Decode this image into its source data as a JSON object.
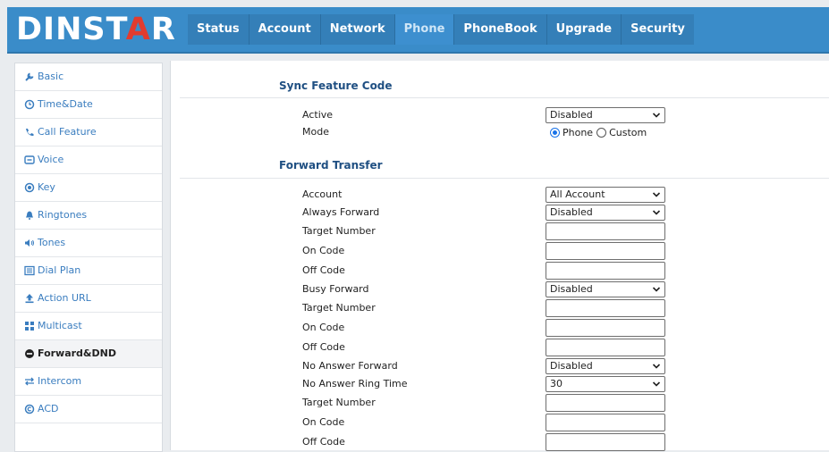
{
  "logo": {
    "text_pre": "DINST",
    "text_mark": "A",
    "text_post": "R"
  },
  "nav": [
    {
      "label": "Status",
      "active": false
    },
    {
      "label": "Account",
      "active": false
    },
    {
      "label": "Network",
      "active": false
    },
    {
      "label": "Phone",
      "active": true
    },
    {
      "label": "PhoneBook",
      "active": false
    },
    {
      "label": "Upgrade",
      "active": false
    },
    {
      "label": "Security",
      "active": false
    }
  ],
  "sidebar": {
    "items": [
      {
        "label": "Basic",
        "icon": "wrench-icon"
      },
      {
        "label": "Time&Date",
        "icon": "clock-icon"
      },
      {
        "label": "Call Feature",
        "icon": "phone-icon"
      },
      {
        "label": "Voice",
        "icon": "voice-icon"
      },
      {
        "label": "Key",
        "icon": "key-icon"
      },
      {
        "label": "Ringtones",
        "icon": "bell-icon"
      },
      {
        "label": "Tones",
        "icon": "speaker-icon"
      },
      {
        "label": "Dial Plan",
        "icon": "list-icon"
      },
      {
        "label": "Action URL",
        "icon": "upload-icon"
      },
      {
        "label": "Multicast",
        "icon": "grid-icon"
      },
      {
        "label": "Forward&DND",
        "icon": "minus-circle-icon",
        "active": true
      },
      {
        "label": "Intercom",
        "icon": "swap-icon"
      },
      {
        "label": "ACD",
        "icon": "copyright-icon"
      }
    ]
  },
  "sync": {
    "title": "Sync Feature Code",
    "active_label": "Active",
    "active_value": "Disabled",
    "mode_label": "Mode",
    "mode_options": [
      "Phone",
      "Custom"
    ],
    "mode_selected": "Phone"
  },
  "forward": {
    "title": "Forward Transfer",
    "account_label": "Account",
    "account_value": "All Account",
    "always_label": "Always Forward",
    "always_value": "Disabled",
    "target_label": "Target Number",
    "on_code_label": "On Code",
    "off_code_label": "Off Code",
    "busy_label": "Busy Forward",
    "busy_value": "Disabled",
    "no_answer_label": "No Answer Forward",
    "no_answer_value": "Disabled",
    "ring_time_label": "No Answer Ring Time",
    "ring_time_value": "30"
  },
  "colors": {
    "header_bg": "#3a8cc9",
    "accent_blue": "#3a7dbf",
    "title_blue": "#1f4f82",
    "logo_red": "#e23b2e"
  }
}
